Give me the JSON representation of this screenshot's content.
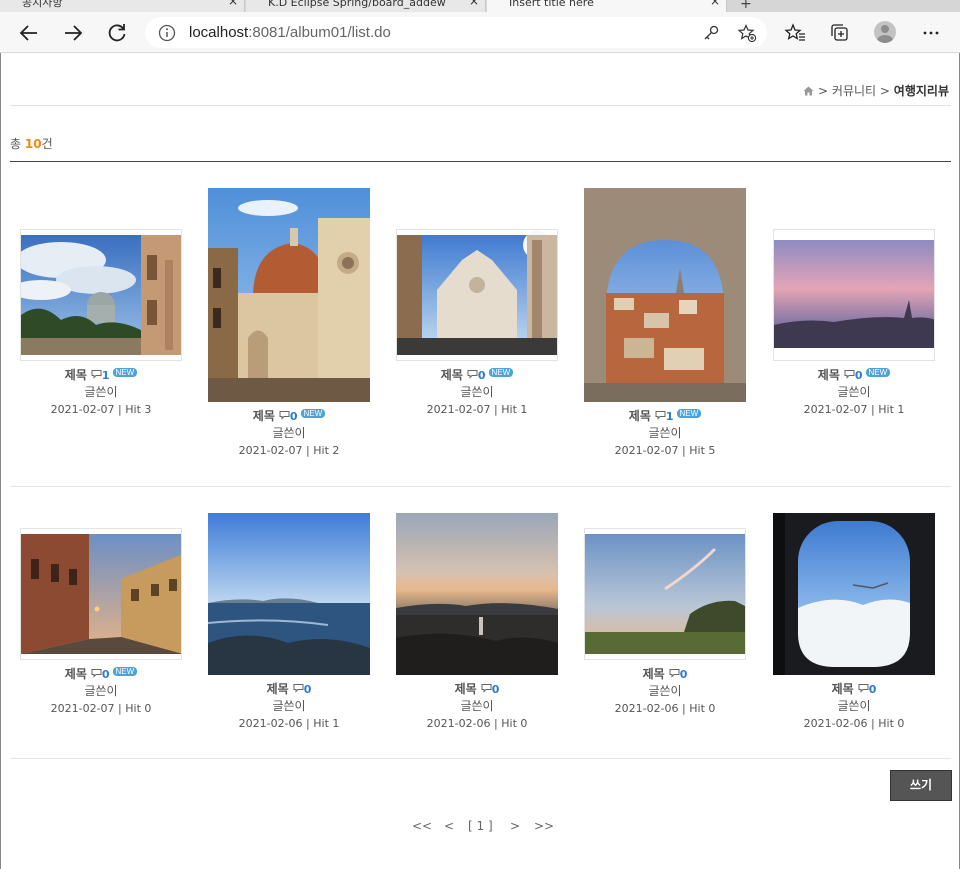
{
  "browser": {
    "tabs": [
      {
        "label": "공지사항"
      },
      {
        "label": "K.D Eclipse Spring/board_addew"
      },
      {
        "label": "Insert title here"
      }
    ],
    "url_host": "localhost",
    "url_rest": ":8081/album01/list.do"
  },
  "breadcrumb": {
    "community": "커뮤니티",
    "current": "여행지리뷰",
    "sep": ">"
  },
  "summary": {
    "prefix": "총 ",
    "count": "10",
    "suffix": "건"
  },
  "cards": [
    {
      "title": "제목",
      "comments": "1",
      "is_new": true,
      "new_label": "NEW",
      "writer": "글쓴이",
      "info": "2021-02-07 | Hit 3"
    },
    {
      "title": "제목",
      "comments": "0",
      "is_new": true,
      "new_label": "NEW",
      "writer": "글쓴이",
      "info": "2021-02-07 | Hit 2"
    },
    {
      "title": "제목",
      "comments": "0",
      "is_new": true,
      "new_label": "NEW",
      "writer": "글쓴이",
      "info": "2021-02-07 | Hit 1"
    },
    {
      "title": "제목",
      "comments": "1",
      "is_new": true,
      "new_label": "NEW",
      "writer": "글쓴이",
      "info": "2021-02-07 | Hit 5"
    },
    {
      "title": "제목",
      "comments": "0",
      "is_new": true,
      "new_label": "NEW",
      "writer": "글쓴이",
      "info": "2021-02-07 | Hit 1"
    },
    {
      "title": "제목",
      "comments": "0",
      "is_new": true,
      "new_label": "NEW",
      "writer": "글쓴이",
      "info": "2021-02-07 | Hit 0"
    },
    {
      "title": "제목",
      "comments": "0",
      "is_new": false,
      "new_label": "",
      "writer": "글쓴이",
      "info": "2021-02-06 | Hit 1"
    },
    {
      "title": "제목",
      "comments": "0",
      "is_new": false,
      "new_label": "",
      "writer": "글쓴이",
      "info": "2021-02-06 | Hit 0"
    },
    {
      "title": "제목",
      "comments": "0",
      "is_new": false,
      "new_label": "",
      "writer": "글쓴이",
      "info": "2021-02-06 | Hit 0"
    },
    {
      "title": "제목",
      "comments": "0",
      "is_new": false,
      "new_label": "",
      "writer": "글쓴이",
      "info": "2021-02-06 | Hit 0"
    }
  ],
  "write_button": "쓰기",
  "pager": {
    "first": "<<",
    "prev": "<",
    "page": "[ 1 ]",
    "next": ">",
    "last": ">>"
  },
  "colors": {
    "accent_count": "#f2890c",
    "new_badge": "#4ea2d8",
    "comment_count": "#2b7bd3",
    "write_button_bg": "#555555"
  },
  "icons": [
    "back-icon",
    "forward-icon",
    "refresh-icon",
    "info-icon",
    "key-icon",
    "favorite-add-icon",
    "favorites-icon",
    "collections-icon",
    "profile-icon",
    "more-icon",
    "home-icon",
    "comment-icon"
  ]
}
